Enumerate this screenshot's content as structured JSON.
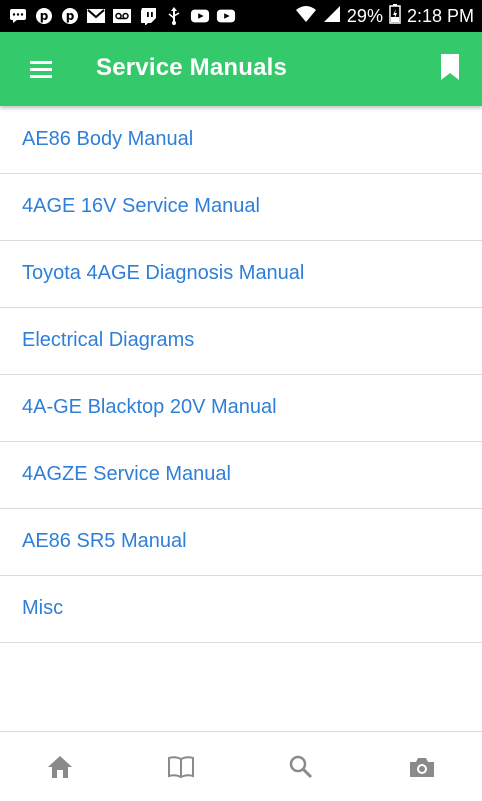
{
  "status_bar": {
    "battery": "29%",
    "time": "2:18 PM",
    "left_icons": [
      "message-icon",
      "pinterest-icon",
      "pinterest-icon",
      "gmail-icon",
      "voicemail-icon",
      "twitch-icon",
      "usb-icon",
      "youtube-icon",
      "youtube-icon"
    ],
    "right_icons": [
      "wifi-icon",
      "signal-icon",
      "battery-icon"
    ]
  },
  "app_bar": {
    "title": "Service Manuals",
    "color": "#34c96b",
    "icons": {
      "menu": "menu-icon",
      "bookmark": "bookmark-icon"
    }
  },
  "list": {
    "items": [
      {
        "label": "AE86 Body Manual"
      },
      {
        "label": "4AGE 16V Service Manual"
      },
      {
        "label": "Toyota 4AGE Diagnosis Manual"
      },
      {
        "label": "Electrical Diagrams"
      },
      {
        "label": "4A-GE Blacktop 20V Manual"
      },
      {
        "label": "4AGZE Service Manual"
      },
      {
        "label": "AE86 SR5 Manual"
      },
      {
        "label": "Misc"
      }
    ],
    "link_color": "#2f7fd8"
  },
  "bottom_nav": {
    "tabs": [
      {
        "icon": "home-icon"
      },
      {
        "icon": "book-icon"
      },
      {
        "icon": "search-icon"
      },
      {
        "icon": "camera-icon"
      }
    ]
  }
}
